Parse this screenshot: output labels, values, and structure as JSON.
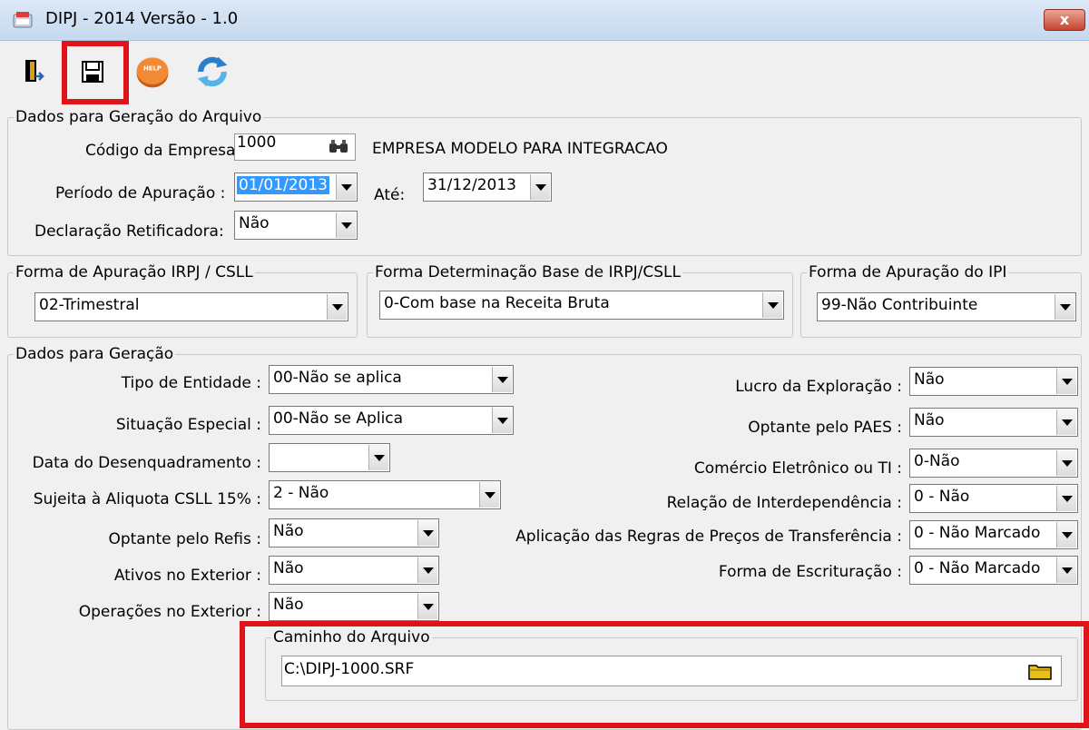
{
  "window": {
    "title": "DIPJ - 2014 Versão - 1.0",
    "close": "x"
  },
  "toolbar": {
    "exit_icon": "exit-door-icon",
    "save_icon": "floppy-disk-icon",
    "help_label": "HELP",
    "refresh_icon": "refresh-icon"
  },
  "gen_file": {
    "legend": "Dados para Geração do Arquivo",
    "empresa_label": "Código da Empresa:",
    "empresa_value": "1000",
    "empresa_name": "EMPRESA MODELO PARA INTEGRACAO",
    "periodo_label": "Período de Apuração :",
    "periodo_de": "01/01/2013",
    "ate_label": "Até:",
    "periodo_ate": "31/12/2013",
    "retificadora_label": "Declaração Retificadora:",
    "retificadora_value": "Não"
  },
  "forma_irpj": {
    "legend": "Forma de Apuração IRPJ / CSLL",
    "value": "02-Trimestral"
  },
  "forma_base": {
    "legend": "Forma Determinação Base de IRPJ/CSLL",
    "value": "0-Com base na Receita Bruta"
  },
  "forma_ipi": {
    "legend": "Forma de  Apuração do IPI",
    "value": "99-Não Contribuinte"
  },
  "dados": {
    "legend": "Dados para Geração",
    "left": [
      {
        "label": "Tipo de Entidade :",
        "value": "00-Não se aplica"
      },
      {
        "label": "Situação Especial :",
        "value": "00-Não se Aplica"
      },
      {
        "label": "Data do Desenquadramento :",
        "value": ""
      },
      {
        "label": "Sujeita à Aliquota CSLL 15% :",
        "value": "2 - Não"
      },
      {
        "label": "Optante pelo Refis :",
        "value": "Não"
      },
      {
        "label": "Ativos no Exterior :",
        "value": "Não"
      },
      {
        "label": "Operações no Exterior :",
        "value": "Não"
      }
    ],
    "right": [
      {
        "label": "Lucro da Exploração :",
        "value": "Não"
      },
      {
        "label": "Optante pelo PAES :",
        "value": "Não"
      },
      {
        "label": "Comércio Eletrônico ou  TI :",
        "value": "0-Não"
      },
      {
        "label": "Relação de Interdependência :",
        "value": "0 - Não"
      },
      {
        "label": "Aplicação das Regras de Preços de Transferência :",
        "value": "0 - Não Marcado"
      },
      {
        "label": "Forma de Escrituração :",
        "value": "0 - Não Marcado"
      }
    ]
  },
  "caminho": {
    "legend": "Caminho do Arquivo",
    "value": "C:\\DIPJ-1000.SRF",
    "folder_icon": "folder-icon"
  },
  "colors": {
    "highlight": "#e0121a",
    "selection": "#3399ff"
  }
}
